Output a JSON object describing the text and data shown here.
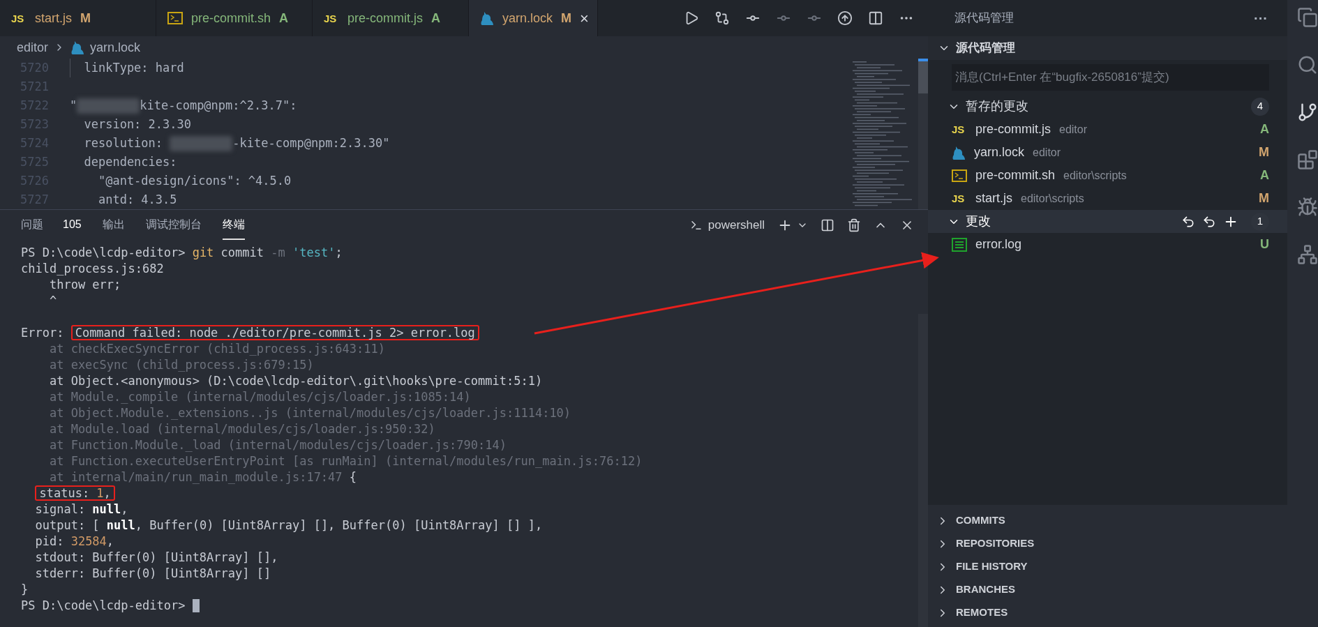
{
  "editor_tabs": [
    {
      "name": "start.js",
      "kind": "js",
      "icon_label": "JS",
      "color": "#d3a66f",
      "badge": "M",
      "selected": false
    },
    {
      "name": "pre-commit.sh",
      "kind": "terminal",
      "color": "#85b77a",
      "badge": "A",
      "selected": false
    },
    {
      "name": "pre-commit.js",
      "kind": "js",
      "icon_label": "JS",
      "color": "#85b77a",
      "badge": "A",
      "selected": false
    },
    {
      "name": "yarn.lock",
      "kind": "yarn",
      "color": "#d3a66f",
      "badge": "M",
      "selected": true,
      "close": "×"
    }
  ],
  "breadcrumb": {
    "folder": "editor",
    "file": "yarn.lock",
    "kind": "yarn"
  },
  "code_lines": [
    {
      "number": "5720",
      "parts": [
        {
          "kind": "guide"
        },
        {
          "kind": "plain",
          "text": "linkType: hard"
        }
      ]
    },
    {
      "number": "5721"
    },
    {
      "number": "5722",
      "parts": [
        {
          "kind": "plain",
          "text": "\""
        },
        {
          "kind": "redacted"
        },
        {
          "kind": "plain",
          "text": "kite-comp@npm:^2.3.7\":"
        }
      ]
    },
    {
      "number": "5723",
      "parts": [
        {
          "kind": "plain",
          "text": "  version: 2.3.30"
        }
      ]
    },
    {
      "number": "5724",
      "parts": [
        {
          "kind": "plain",
          "text": "  resolution: "
        },
        {
          "kind": "redacted"
        },
        {
          "kind": "plain",
          "text": "-kite-comp@npm:2.3.30\""
        }
      ]
    },
    {
      "number": "5725",
      "parts": [
        {
          "kind": "plain",
          "text": "  dependencies:"
        }
      ]
    },
    {
      "number": "5726",
      "parts": [
        {
          "kind": "plain",
          "text": "    \"@ant-design/icons\": ^4.5.0"
        }
      ]
    },
    {
      "number": "5727",
      "parts": [
        {
          "kind": "plain",
          "text": "    antd: 4.3.5"
        }
      ]
    }
  ],
  "panel_tabs": [
    {
      "label": "问题",
      "count": "105",
      "selected": false
    },
    {
      "label": "输出",
      "selected": false
    },
    {
      "label": "调试控制台",
      "selected": false
    },
    {
      "label": "终端",
      "selected": true
    }
  ],
  "terminal": {
    "shell": "powershell",
    "cursor_visible": true,
    "lines": [
      {
        "parts": [
          {
            "kind": "plain",
            "text": "PS D:\\code\\lcdp-editor> "
          },
          {
            "kind": "keyword",
            "text": "git"
          },
          {
            "kind": "plain",
            "text": " commit "
          },
          {
            "kind": "dim",
            "text": "-m"
          },
          {
            "kind": "string",
            "text": " 'test'"
          },
          {
            "kind": "plain",
            "text": ";"
          }
        ]
      },
      {
        "parts": [
          {
            "kind": "plain",
            "text": "child_process.js:682"
          }
        ]
      },
      {
        "parts": [
          {
            "kind": "plain",
            "text": "    throw err;"
          }
        ]
      },
      {
        "parts": [
          {
            "kind": "plain",
            "text": "    ^"
          }
        ]
      },
      {
        "kind": "blank"
      },
      {
        "parts": [
          {
            "kind": "plain",
            "text": "Error: "
          },
          {
            "kind": "box",
            "parts": [
              {
                "kind": "plain",
                "text": "Command failed: node ./editor/pre-commit.js 2> error.log"
              }
            ]
          }
        ]
      },
      {
        "parts": [
          {
            "kind": "dim",
            "text": "    at checkExecSyncError (child_process.js:643:11)"
          }
        ]
      },
      {
        "parts": [
          {
            "kind": "dim",
            "text": "    at execSync (child_process.js:679:15)"
          }
        ]
      },
      {
        "parts": [
          {
            "kind": "plain",
            "text": "    at Object.<anonymous> (D:\\code\\lcdp-editor\\.git\\hooks\\pre-commit:5:1)"
          }
        ]
      },
      {
        "parts": [
          {
            "kind": "dim",
            "text": "    at Module._compile (internal/modules/cjs/loader.js:1085:14)"
          }
        ]
      },
      {
        "parts": [
          {
            "kind": "dim",
            "text": "    at Object.Module._extensions..js (internal/modules/cjs/loader.js:1114:10)"
          }
        ]
      },
      {
        "parts": [
          {
            "kind": "dim",
            "text": "    at Module.load (internal/modules/cjs/loader.js:950:32)"
          }
        ]
      },
      {
        "parts": [
          {
            "kind": "dim",
            "text": "    at Function.Module._load (internal/modules/cjs/loader.js:790:14)"
          }
        ]
      },
      {
        "parts": [
          {
            "kind": "dim",
            "text": "    at Function.executeUserEntryPoint [as runMain] (internal/modules/run_main.js:76:12)"
          }
        ]
      },
      {
        "parts": [
          {
            "kind": "dim",
            "text": "    at internal/main/run_main_module.js:17:47"
          },
          {
            "kind": "plain",
            "text": " {"
          }
        ]
      },
      {
        "parts": [
          {
            "kind": "indent"
          },
          {
            "kind": "box",
            "parts": [
              {
                "kind": "plain",
                "text": "status: "
              },
              {
                "kind": "number",
                "text": "1"
              },
              {
                "kind": "plain",
                "text": ","
              }
            ]
          }
        ]
      },
      {
        "parts": [
          {
            "kind": "plain",
            "text": "  signal: "
          },
          {
            "kind": "bold",
            "text": "null"
          },
          {
            "kind": "plain",
            "text": ","
          }
        ]
      },
      {
        "parts": [
          {
            "kind": "plain",
            "text": "  output: [ "
          },
          {
            "kind": "bold",
            "text": "null"
          },
          {
            "kind": "plain",
            "text": ", Buffer(0) [Uint8Array] [], Buffer(0) [Uint8Array] [] ],"
          }
        ]
      },
      {
        "parts": [
          {
            "kind": "plain",
            "text": "  pid: "
          },
          {
            "kind": "number",
            "text": "32584"
          },
          {
            "kind": "plain",
            "text": ","
          }
        ]
      },
      {
        "parts": [
          {
            "kind": "plain",
            "text": "  stdout: Buffer(0) [Uint8Array] [],"
          }
        ]
      },
      {
        "parts": [
          {
            "kind": "plain",
            "text": "  stderr: Buffer(0) [Uint8Array] []"
          }
        ]
      },
      {
        "parts": [
          {
            "kind": "plain",
            "text": "}"
          }
        ]
      },
      {
        "parts": [
          {
            "kind": "plain",
            "text": "PS D:\\code\\lcdp-editor> "
          }
        ]
      }
    ]
  },
  "sidebar": {
    "title": "源代码管理",
    "more": "···",
    "section": "源代码管理",
    "message_placeholder": "消息(Ctrl+Enter 在“bugfix-2650816”提交)",
    "groups": [
      {
        "label": "暂存的更改",
        "count": "4",
        "highlighted": false,
        "items": [
          {
            "name": "pre-commit.js",
            "path": "editor",
            "kind": "js",
            "icon_label": "JS",
            "color": "#85b77a",
            "badge": "A"
          },
          {
            "name": "yarn.lock",
            "path": "editor",
            "kind": "yarn",
            "color": "#d3a66f",
            "badge": "M"
          },
          {
            "name": "pre-commit.sh",
            "path": "editor\\scripts",
            "kind": "terminal",
            "color": "#85b77a",
            "badge": "A"
          },
          {
            "name": "start.js",
            "path": "editor\\scripts",
            "kind": "js",
            "icon_label": "JS",
            "color": "#d3a66f",
            "badge": "M"
          }
        ]
      },
      {
        "label": "更改",
        "count": "1",
        "highlighted": true,
        "items": [
          {
            "name": "error.log",
            "kind": "log",
            "color": "#85b77a",
            "badge": "U"
          }
        ]
      }
    ],
    "views": [
      {
        "label": "COMMITS",
        "expanded": false
      },
      {
        "label": "REPOSITORIES",
        "expanded": false
      },
      {
        "label": "FILE HISTORY",
        "expanded": false
      },
      {
        "label": "BRANCHES",
        "expanded": false
      },
      {
        "label": "REMOTES",
        "expanded": false
      }
    ]
  }
}
